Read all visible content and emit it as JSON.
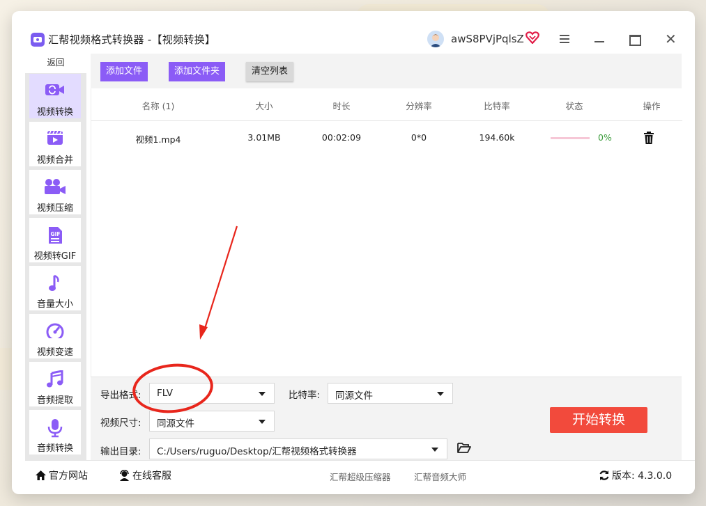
{
  "window": {
    "title": "汇帮视频格式转换器 -【视频转换】",
    "username": "awS8PVjPqlsZ",
    "icons": [
      "app-logo-icon",
      "user-avatar-icon",
      "vip-heart-icon",
      "menu-icon",
      "minimize-icon",
      "maximize-icon",
      "close-icon"
    ]
  },
  "sidebar": {
    "back_label": "返回",
    "items": [
      {
        "label": "视频转换",
        "icon": "video-convert-icon",
        "active": true
      },
      {
        "label": "视频合并",
        "icon": "video-merge-icon",
        "active": false
      },
      {
        "label": "视频压缩",
        "icon": "video-compress-icon",
        "active": false
      },
      {
        "label": "视频转GIF",
        "icon": "gif-icon",
        "active": false
      },
      {
        "label": "音量大小",
        "icon": "music-note-icon",
        "active": false
      },
      {
        "label": "视频变速",
        "icon": "speedometer-icon",
        "active": false
      },
      {
        "label": "音频提取",
        "icon": "music-extract-icon",
        "active": false
      },
      {
        "label": "音频转换",
        "icon": "microphone-icon",
        "active": false
      }
    ],
    "accent_color": "#8b5cf6"
  },
  "toolbar": {
    "add_file": "添加文件",
    "add_folder": "添加文件夹",
    "clear_list": "清空列表"
  },
  "table": {
    "headers": [
      "名称 (1)",
      "大小",
      "时长",
      "分辨率",
      "比特率",
      "状态",
      "操作"
    ],
    "rows": [
      {
        "name": "视频1.mp4",
        "size": "3.01MB",
        "duration": "00:02:09",
        "resolution": "0*0",
        "bitrate": "194.60k",
        "progress": 0,
        "status_text": "0%",
        "action_icon": "trash-icon"
      }
    ]
  },
  "settings": {
    "format_label": "导出格式:",
    "format_value": "FLV",
    "bitrate_label": "比特率:",
    "bitrate_value": "同源文件",
    "size_label": "视频尺寸:",
    "size_value": "同源文件",
    "output_label": "输出目录:",
    "output_value": "C:/Users/ruguo/Desktop/汇帮视频格式转换器",
    "start_button": "开始转换",
    "start_color": "#f24a3c"
  },
  "footer": {
    "website": "官方网站",
    "support": "在线客服",
    "link1": "汇帮超级压缩器",
    "link2": "汇帮音频大师",
    "version": "版本: 4.3.0.0"
  }
}
